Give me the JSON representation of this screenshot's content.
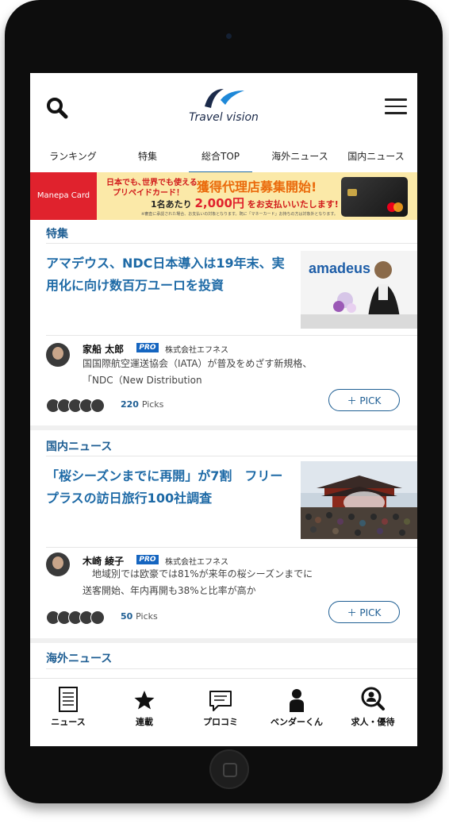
{
  "header": {
    "logo_text": "Travel vision",
    "search_icon": "search-icon",
    "menu_icon": "hamburger-menu-icon"
  },
  "tabs": [
    {
      "label": "ランキング",
      "active": false
    },
    {
      "label": "特集",
      "active": false
    },
    {
      "label": "総合TOP",
      "active": true
    },
    {
      "label": "海外ニュース",
      "active": false
    },
    {
      "label": "国内ニュース",
      "active": false
    }
  ],
  "banner": {
    "brand": "Manepa Card",
    "line1": "日本でも､世界でも使える",
    "line2": "プリペイドカード！",
    "headline": "獲得代理店募集開始!",
    "per_person": "1名あたり",
    "amount": "2,000円",
    "amount_tail": "をお支払いいたします!",
    "fine_print": "※審査に承認された場合、お支払いの対象となります。既に「マネーカード」お持ちの方は対象外となります。"
  },
  "articles": [
    {
      "section": "特集",
      "headline": "アマデウス、NDC日本導入は19年末、実用化に向け数百万ユーロを投資",
      "thumb_text": "amadeus",
      "author": "家船 太郎",
      "pro": "PRO",
      "company": "株式会社エフネス",
      "comment": "国国際航空運送協会（IATA）が普及をめざす新規格、「NDC（New Distribution",
      "picks": "220",
      "picks_suffix": "Picks",
      "pick_button": "＋ PICK"
    },
    {
      "section": "国内ニュース",
      "headline": "「桜シーズンまでに再開」が7割　フリープラスの訪日旅行100社調査",
      "author": "木崎 綾子",
      "pro": "PRO",
      "company": "株式会社エフネス",
      "comment": "　地域別では欧豪では81%が来年の桜シーズンまでに送客開始、年内再開も38%と比率が高か",
      "picks": "50",
      "picks_suffix": "Picks",
      "pick_button": "＋ PICK"
    }
  ],
  "next_section": "海外ニュース",
  "bottom_nav": [
    {
      "label": "ニュース",
      "icon": "newspaper-icon"
    },
    {
      "label": "連載",
      "icon": "star-icon"
    },
    {
      "label": "プロコミ",
      "icon": "chat-bubble-icon"
    },
    {
      "label": "ベンダーくん",
      "icon": "person-icon"
    },
    {
      "label": "求人・優待",
      "icon": "person-search-icon"
    }
  ]
}
